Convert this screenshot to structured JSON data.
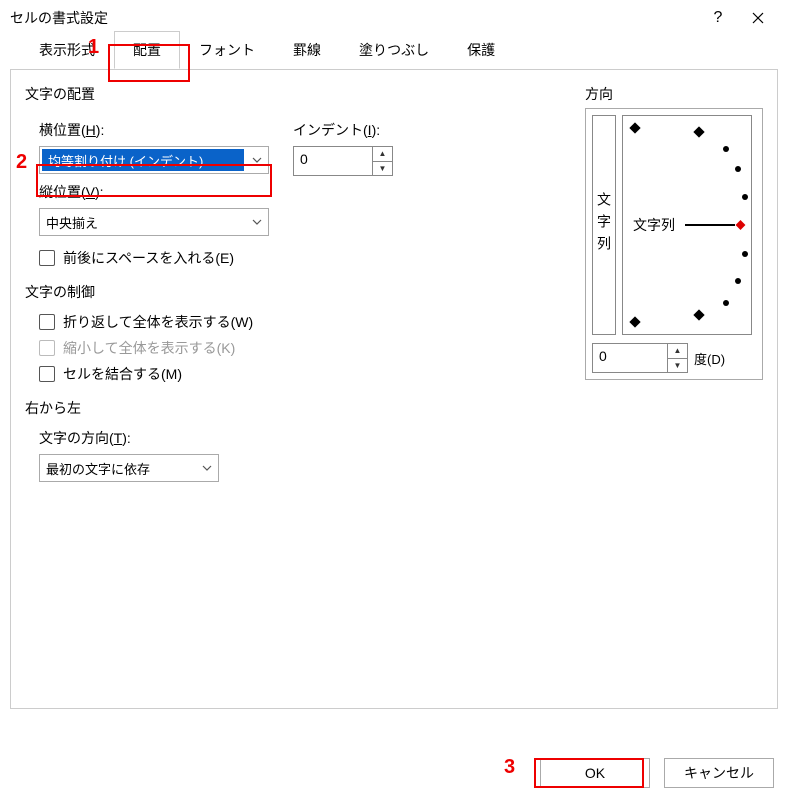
{
  "window": {
    "title": "セルの書式設定"
  },
  "tabs": [
    "表示形式",
    "配置",
    "フォント",
    "罫線",
    "塗りつぶし",
    "保護"
  ],
  "active_tab_index": 1,
  "alignment": {
    "group_label": "文字の配置",
    "horizontal_label_pre": "横位置(",
    "horizontal_label_key": "H",
    "horizontal_label_post": "):",
    "horizontal_value": "均等割り付け (インデント)",
    "indent_label_pre": "インデント(",
    "indent_label_key": "I",
    "indent_label_post": "):",
    "indent_value": "0",
    "vertical_label_pre": "縦位置(",
    "vertical_label_key": "V",
    "vertical_label_post": "):",
    "vertical_value": "中央揃え",
    "justify_space_pre": "前後にスペースを入れる(",
    "justify_space_key": "E",
    "justify_space_post": ")"
  },
  "control": {
    "group_label": "文字の制御",
    "wrap_pre": "折り返して全体を表示する(",
    "wrap_key": "W",
    "wrap_post": ")",
    "shrink": "縮小して全体を表示する(K)",
    "merge_pre": "セルを結合する(",
    "merge_key": "M",
    "merge_post": ")"
  },
  "rtl": {
    "group_label": "右から左",
    "direction_label_pre": "文字の方向(",
    "direction_label_key": "T",
    "direction_label_post": "):",
    "direction_value": "最初の文字に依存"
  },
  "orientation": {
    "group_label": "方向",
    "vertical_text": "文字列",
    "dial_label": "文字列",
    "deg_value": "0",
    "deg_label_pre": "度(",
    "deg_label_key": "D",
    "deg_label_post": ")"
  },
  "buttons": {
    "ok": "OK",
    "cancel": "キャンセル"
  },
  "annotations": {
    "n1": "1",
    "n2": "2",
    "n3": "3"
  }
}
